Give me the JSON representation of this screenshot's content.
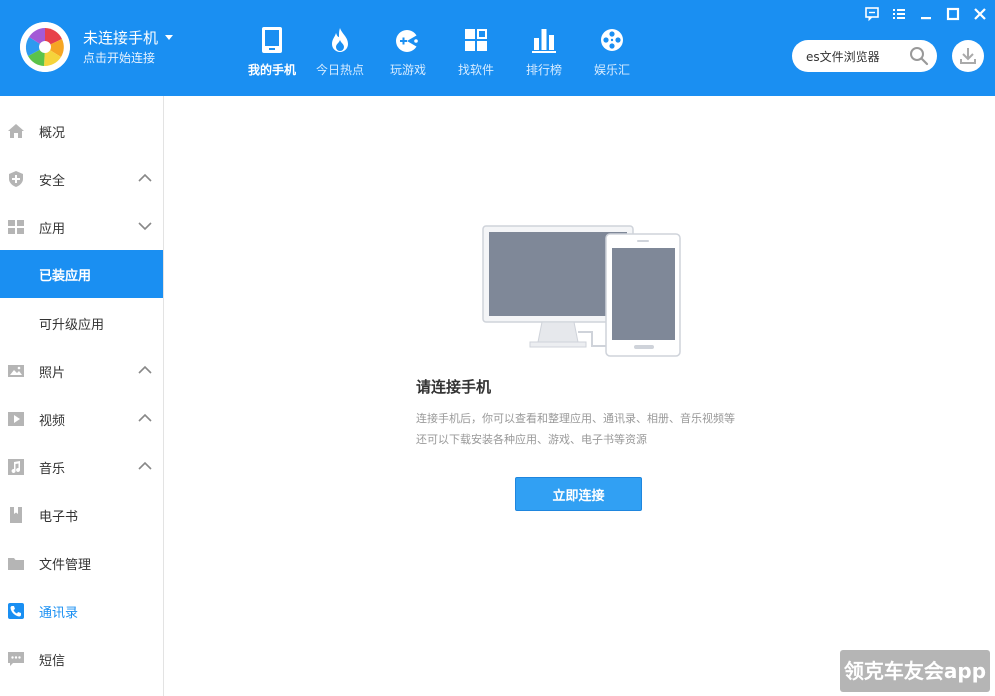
{
  "header": {
    "device_status": "未连接手机",
    "device_hint": "点击开始连接",
    "nav": [
      {
        "label": "我的手机",
        "icon": "phone-icon",
        "active": true
      },
      {
        "label": "今日热点",
        "icon": "flame-icon",
        "active": false
      },
      {
        "label": "玩游戏",
        "icon": "gamepad-icon",
        "active": false
      },
      {
        "label": "找软件",
        "icon": "apps-grid-icon",
        "active": false
      },
      {
        "label": "排行榜",
        "icon": "bar-chart-icon",
        "active": false
      },
      {
        "label": "娱乐汇",
        "icon": "film-reel-icon",
        "active": false
      }
    ],
    "search": {
      "value": "es文件浏览器"
    },
    "window_controls": [
      "feedback-icon",
      "menu-icon",
      "minimize-icon",
      "maximize-icon",
      "close-icon"
    ]
  },
  "sidebar": {
    "items": [
      {
        "label": "概况",
        "icon": "home-icon",
        "chevron": "none"
      },
      {
        "label": "安全",
        "icon": "shield-icon",
        "chevron": "up"
      },
      {
        "label": "应用",
        "icon": "apps-icon",
        "chevron": "down"
      },
      {
        "label": "已装应用",
        "sub": true,
        "selected": true
      },
      {
        "label": "可升级应用",
        "sub": true
      },
      {
        "label": "照片",
        "icon": "photo-icon",
        "chevron": "up"
      },
      {
        "label": "视频",
        "icon": "video-icon",
        "chevron": "up"
      },
      {
        "label": "音乐",
        "icon": "music-icon",
        "chevron": "up"
      },
      {
        "label": "电子书",
        "icon": "book-icon",
        "chevron": "none"
      },
      {
        "label": "文件管理",
        "icon": "folder-icon",
        "chevron": "none"
      },
      {
        "label": "通讯录",
        "icon": "contacts-icon",
        "chevron": "none",
        "highlight": true
      },
      {
        "label": "短信",
        "icon": "sms-icon",
        "chevron": "none"
      }
    ]
  },
  "main": {
    "title": "请连接手机",
    "desc_line1": "连接手机后，你可以查看和整理应用、通讯录、相册、音乐视频等",
    "desc_line2": "还可以下载安装各种应用、游戏、电子书等资源",
    "connect_button": "立即连接"
  },
  "watermark": "领克车友会app",
  "colors": {
    "accent": "#1a8ff2",
    "button": "#31a0f3",
    "sidebar_icon": "#b5b5b5",
    "contacts_icon": "#1a8ff2"
  }
}
